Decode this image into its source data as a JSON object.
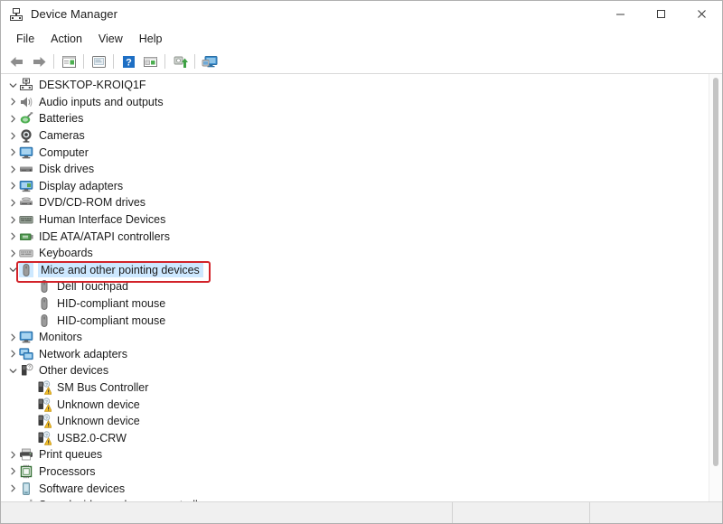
{
  "window": {
    "title": "Device Manager",
    "icon": "device-manager-icon",
    "caption": {
      "minimize": "─",
      "maximize": "□",
      "close": "✕"
    }
  },
  "menubar": {
    "items": [
      {
        "label": "File"
      },
      {
        "label": "Action"
      },
      {
        "label": "View"
      },
      {
        "label": "Help"
      }
    ]
  },
  "toolbar": {
    "buttons": [
      {
        "name": "back-button",
        "icon": "back-arrow-icon"
      },
      {
        "name": "forward-button",
        "icon": "forward-arrow-icon"
      },
      {
        "name": "properties-button",
        "icon": "properties-icon"
      },
      {
        "name": "update-driver-button",
        "icon": "update-driver-icon"
      },
      {
        "name": "help-button",
        "icon": "help-question-icon"
      },
      {
        "name": "scan-hardware-button",
        "icon": "scan-hardware-icon"
      },
      {
        "name": "uninstall-device-button",
        "icon": "uninstall-device-icon"
      },
      {
        "name": "show-hidden-devices-button",
        "icon": "monitor-display-icon"
      }
    ]
  },
  "tree": {
    "root": {
      "label": "DESKTOP-KROIQ1F",
      "icon": "computer-root-icon",
      "expanded": true
    },
    "items": [
      {
        "label": "Audio inputs and outputs",
        "icon": "speaker-icon",
        "level": 1,
        "expander": "collapsed"
      },
      {
        "label": "Batteries",
        "icon": "battery-icon",
        "level": 1,
        "expander": "collapsed"
      },
      {
        "label": "Cameras",
        "icon": "camera-icon",
        "level": 1,
        "expander": "collapsed"
      },
      {
        "label": "Computer",
        "icon": "monitor-icon",
        "level": 1,
        "expander": "collapsed"
      },
      {
        "label": "Disk drives",
        "icon": "disk-drive-icon",
        "level": 1,
        "expander": "collapsed"
      },
      {
        "label": "Display adapters",
        "icon": "display-adapter-icon",
        "level": 1,
        "expander": "collapsed"
      },
      {
        "label": "DVD/CD-ROM drives",
        "icon": "dvd-drive-icon",
        "level": 1,
        "expander": "collapsed"
      },
      {
        "label": "Human Interface Devices",
        "icon": "hid-icon",
        "level": 1,
        "expander": "collapsed"
      },
      {
        "label": "IDE ATA/ATAPI controllers",
        "icon": "ide-controller-icon",
        "level": 1,
        "expander": "collapsed"
      },
      {
        "label": "Keyboards",
        "icon": "keyboard-icon",
        "level": 1,
        "expander": "collapsed"
      },
      {
        "label": "Mice and other pointing devices",
        "icon": "mouse-icon",
        "level": 1,
        "expander": "expanded",
        "selected": true,
        "highlighted": true
      },
      {
        "label": "Dell Touchpad",
        "icon": "mouse-icon",
        "level": 2,
        "expander": "none"
      },
      {
        "label": "HID-compliant mouse",
        "icon": "mouse-icon",
        "level": 2,
        "expander": "none"
      },
      {
        "label": "HID-compliant mouse",
        "icon": "mouse-icon",
        "level": 2,
        "expander": "none"
      },
      {
        "label": "Monitors",
        "icon": "monitor-icon",
        "level": 1,
        "expander": "collapsed"
      },
      {
        "label": "Network adapters",
        "icon": "network-adapter-icon",
        "level": 1,
        "expander": "collapsed"
      },
      {
        "label": "Other devices",
        "icon": "other-device-icon",
        "level": 1,
        "expander": "expanded"
      },
      {
        "label": "SM Bus Controller",
        "icon": "unknown-device-warning-icon",
        "level": 2,
        "expander": "none"
      },
      {
        "label": "Unknown device",
        "icon": "unknown-device-warning-icon",
        "level": 2,
        "expander": "none"
      },
      {
        "label": "Unknown device",
        "icon": "unknown-device-warning-icon",
        "level": 2,
        "expander": "none"
      },
      {
        "label": "USB2.0-CRW",
        "icon": "unknown-device-warning-icon",
        "level": 2,
        "expander": "none"
      },
      {
        "label": "Print queues",
        "icon": "printer-icon",
        "level": 1,
        "expander": "collapsed"
      },
      {
        "label": "Processors",
        "icon": "processor-icon",
        "level": 1,
        "expander": "collapsed"
      },
      {
        "label": "Software devices",
        "icon": "software-device-icon",
        "level": 1,
        "expander": "collapsed"
      },
      {
        "label": "Sound, video and game controllers",
        "icon": "sound-controller-icon",
        "level": 1,
        "expander": "collapsed"
      }
    ]
  },
  "annotation": {
    "target_label": "Mice and other pointing devices",
    "color": "#d2232a"
  },
  "statusbar": {
    "message": "",
    "segment_2": "",
    "segment_3": ""
  },
  "colors": {
    "selection": "#cde8ff",
    "annotation": "#d2232a",
    "warning": "#f5c02b",
    "accent_blue": "#3b97d3"
  }
}
